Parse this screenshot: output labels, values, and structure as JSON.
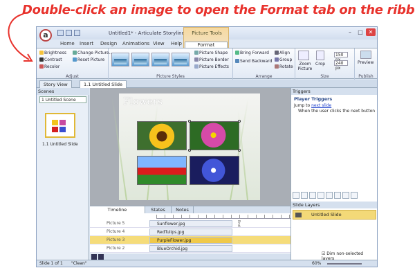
{
  "headline": "Double-click an image to open the Format tab on the ribbon",
  "window": {
    "title": "Untitled1* - Articulate Storyline",
    "logo_letter": "a",
    "picture_tools": "Picture Tools"
  },
  "tabs": [
    "Home",
    "Insert",
    "Design",
    "Animations",
    "View",
    "Help"
  ],
  "active_tab": "Format",
  "ribbon": {
    "adjust": {
      "brightness": "Brightness",
      "contrast": "Contrast",
      "recolor": "Recolor",
      "change_picture": "Change Picture...",
      "reset_picture": "Reset Picture",
      "label": "Adjust"
    },
    "picture_styles": {
      "label": "Picture Styles",
      "shape": "Picture Shape",
      "border": "Picture Border",
      "effects": "Picture Effects"
    },
    "arrange": {
      "label": "Arrange",
      "bring_forward": "Bring Forward",
      "send_backward": "Send Backward",
      "align": "Align",
      "group": "Group",
      "rotate": "Rotate"
    },
    "size": {
      "label": "Size",
      "zoom_picture": "Zoom Picture",
      "crop": "Crop",
      "width": "150 px",
      "height": "240 px"
    },
    "publish": {
      "label": "Publish",
      "preview": "Preview"
    }
  },
  "doc_tabs": [
    "Story View",
    "1.1 Untitled Slide"
  ],
  "scenes": {
    "header": "Scenes",
    "selected": "1 Untitled Scene",
    "thumb_label": "1.1 Untitled Slide"
  },
  "slide": {
    "title": "Flowers"
  },
  "timeline": {
    "tabs": [
      "Timeline",
      "States",
      "Notes"
    ],
    "rows": [
      {
        "name": "Picture 5",
        "file": "Sunflower.jpg"
      },
      {
        "name": "Picture 4",
        "file": "RedTulips.jpg"
      },
      {
        "name": "Picture 3",
        "file": "PurpleFlower.jpg"
      },
      {
        "name": "Picture 2",
        "file": "BlueOrchid.jpg"
      }
    ],
    "end_label": "End"
  },
  "triggers": {
    "header": "Triggers",
    "title": "Player Triggers",
    "line1_prefix": "Jump to",
    "line1_link": "next slide",
    "line2": "When the user clicks the next button"
  },
  "layers": {
    "header": "Slide Layers",
    "row": "Untitled Slide",
    "dim": "Dim non-selected layers"
  },
  "status": {
    "slide": "Slide 1 of 1",
    "theme": "\"Clean\"",
    "zoom": "60%"
  },
  "colors": {
    "headline": "#e8322c",
    "accent": "#f3d978"
  }
}
